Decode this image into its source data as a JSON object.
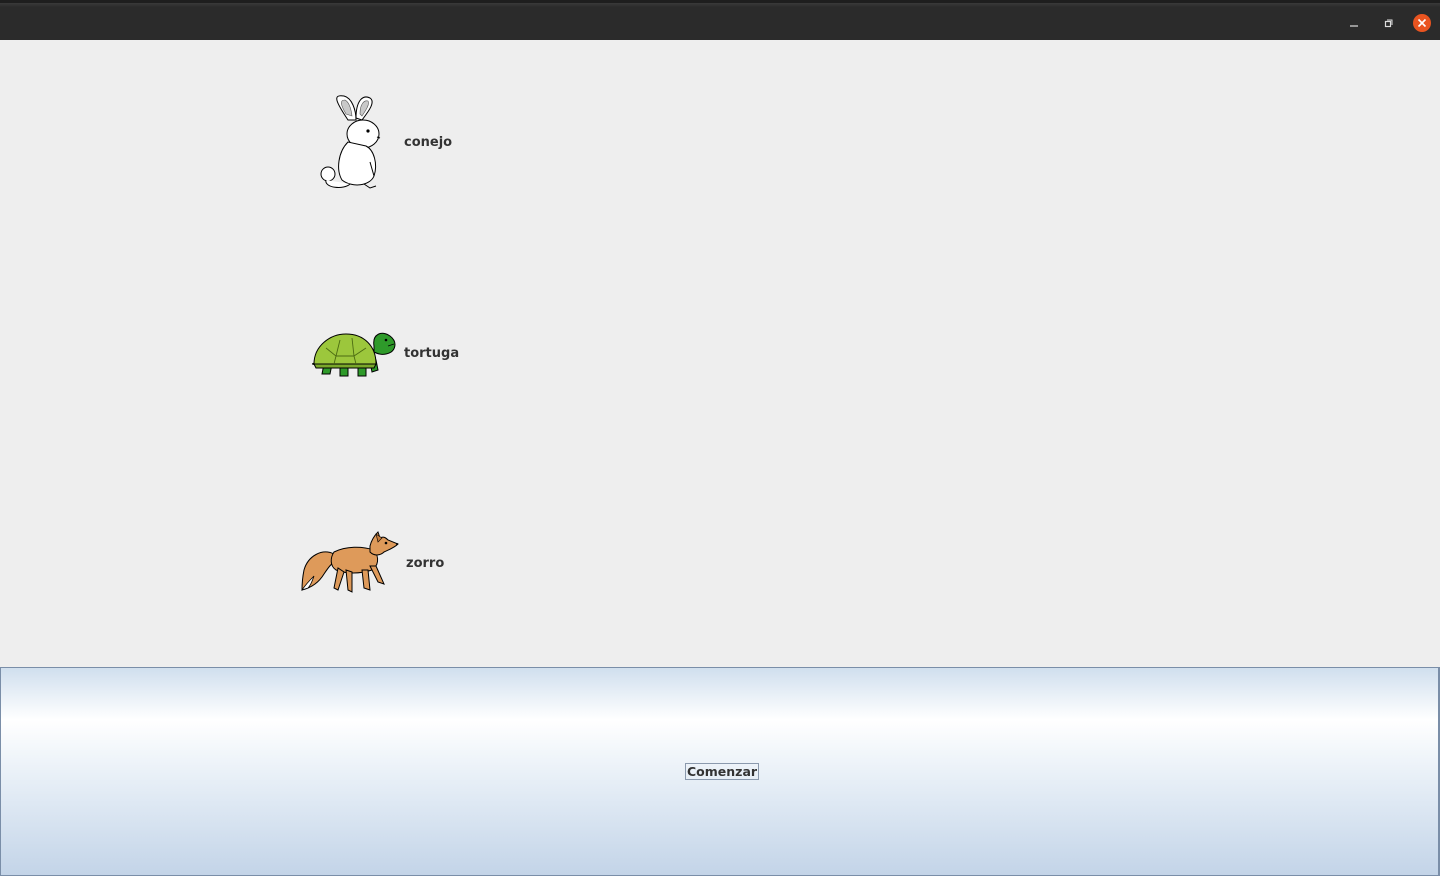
{
  "window": {
    "controls": {
      "minimize_icon": "minimize-icon",
      "maximize_icon": "maximize-icon",
      "close_icon": "close-icon",
      "close_color": "#e95420"
    }
  },
  "animals": [
    {
      "label": "conejo",
      "icon": "rabbit-icon"
    },
    {
      "label": "tortuga",
      "icon": "turtle-icon"
    },
    {
      "label": "zorro",
      "icon": "fox-icon"
    }
  ],
  "controls": {
    "start_label": "Comenzar"
  }
}
